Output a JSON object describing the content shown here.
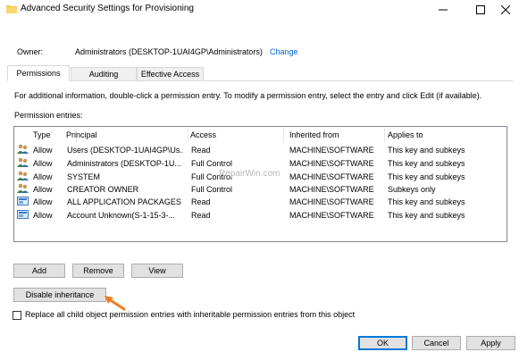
{
  "window": {
    "title": "Advanced Security Settings for Provisioning"
  },
  "owner": {
    "label": "Owner:",
    "value": "Administrators (DESKTOP-1UAI4GP\\Administrators)",
    "change_link": "Change"
  },
  "tabs": [
    {
      "label": "Permissions",
      "active": true
    },
    {
      "label": "Auditing",
      "active": false
    },
    {
      "label": "Effective Access",
      "active": false
    }
  ],
  "info_text": "For additional information, double-click a permission entry. To modify a permission entry, select the entry and click Edit (if available).",
  "entries_label": "Permission entries:",
  "columns": [
    "Type",
    "Principal",
    "Access",
    "Inherited from",
    "Applies to"
  ],
  "entries": [
    {
      "icon": "users-icon",
      "type": "Allow",
      "principal": "Users (DESKTOP-1UAI4GP\\Us...",
      "access": "Read",
      "inherited_from": "MACHINE\\SOFTWARE",
      "applies_to": "This key and subkeys"
    },
    {
      "icon": "users-icon",
      "type": "Allow",
      "principal": "Administrators (DESKTOP-1U...",
      "access": "Full Control",
      "inherited_from": "MACHINE\\SOFTWARE",
      "applies_to": "This key and subkeys"
    },
    {
      "icon": "users-icon",
      "type": "Allow",
      "principal": "SYSTEM",
      "access": "Full Control",
      "inherited_from": "MACHINE\\SOFTWARE",
      "applies_to": "This key and subkeys"
    },
    {
      "icon": "users-icon",
      "type": "Allow",
      "principal": "CREATOR OWNER",
      "access": "Full Control",
      "inherited_from": "MACHINE\\SOFTWARE",
      "applies_to": "Subkeys only"
    },
    {
      "icon": "package-icon",
      "type": "Allow",
      "principal": "ALL APPLICATION PACKAGES",
      "access": "Read",
      "inherited_from": "MACHINE\\SOFTWARE",
      "applies_to": "This key and subkeys"
    },
    {
      "icon": "package-icon",
      "type": "Allow",
      "principal": "Account Unknown(S-1-15-3-...",
      "access": "Read",
      "inherited_from": "MACHINE\\SOFTWARE",
      "applies_to": "This key and subkeys"
    }
  ],
  "watermark": "RepairWin.com",
  "buttons": {
    "add": "Add",
    "remove": "Remove",
    "view": "View",
    "disable_inheritance": "Disable inheritance",
    "ok": "OK",
    "cancel": "Cancel",
    "apply": "Apply"
  },
  "replace_checkbox": {
    "label": "Replace all child object permission entries with inheritable permission entries from this object",
    "checked": false
  },
  "colors": {
    "link": "#0066cc",
    "default_button_border": "#0078d7",
    "arrow": "#f07c21"
  }
}
